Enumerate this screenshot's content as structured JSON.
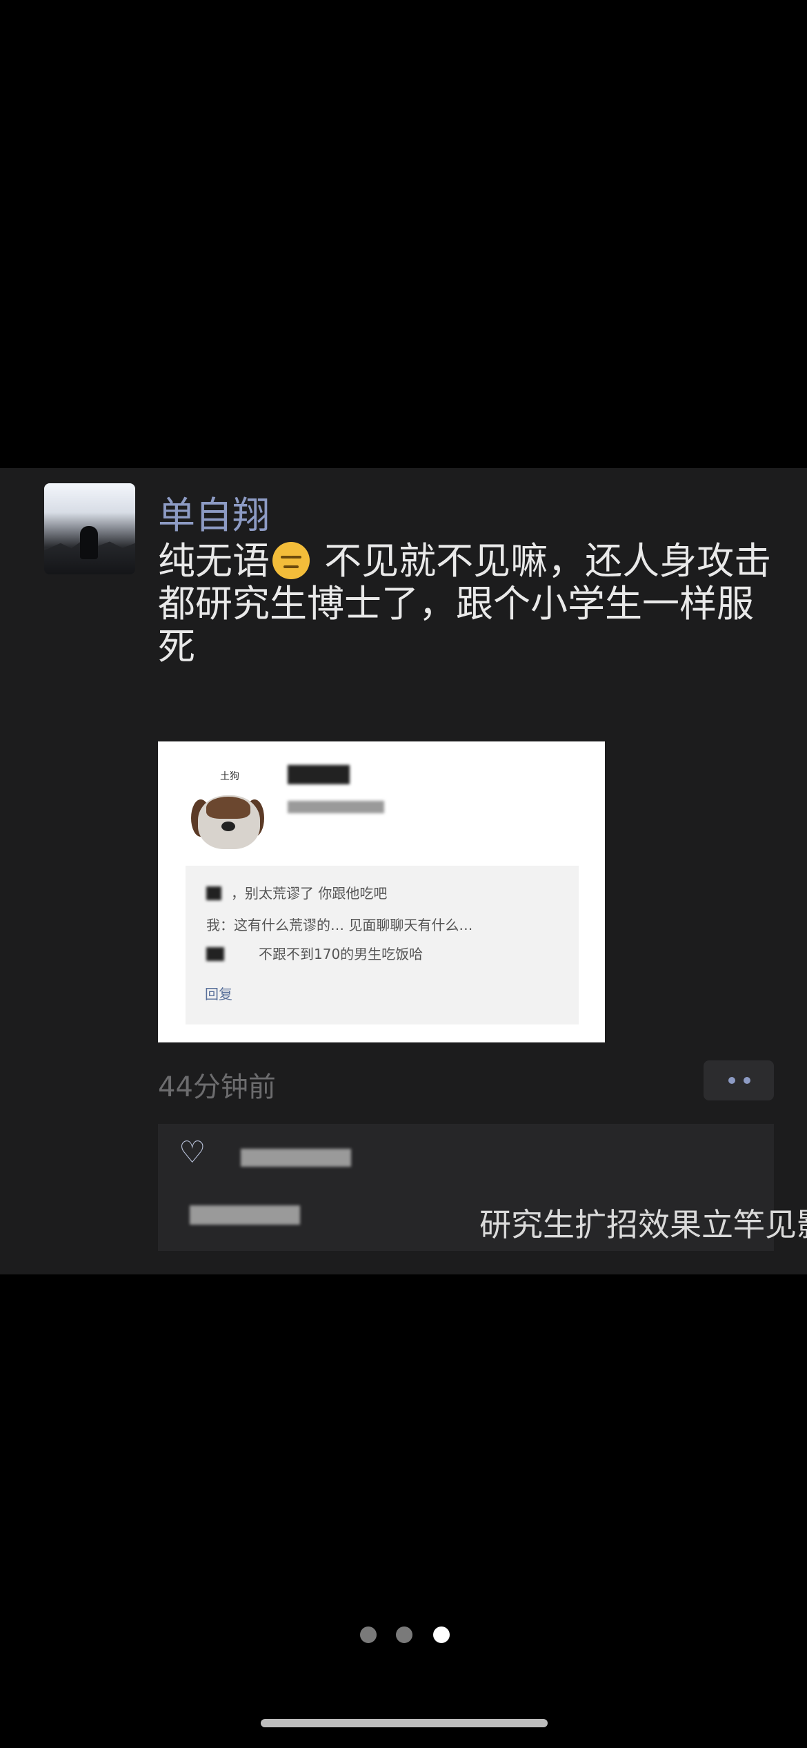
{
  "post": {
    "author": "单自翔",
    "text_line1_a": "纯无语",
    "text_line1_b": " 不见就不见嘛，还人身攻击",
    "text_line2": "都研究生博士了，跟个小学生一样服死",
    "emoji": "neutral-face",
    "time": "44分钟前",
    "more_icon": "more-dots-icon"
  },
  "screenshot": {
    "dog_label": "土狗",
    "comment1": "，别太荒谬了 你跟他吃吧",
    "comment2": "我：这有什么荒谬的… 见面聊聊天有什么…",
    "comment3": "不跟不到170的男生吃饭哈",
    "reply": "回复"
  },
  "interactions": {
    "like_icon": "heart-icon",
    "comment_text": "研究生扩招效果立竿见影",
    "comment_emoji": "grinning-cat-icon"
  },
  "pager": {
    "count": 3,
    "active_index": 2
  },
  "colors": {
    "name_blue": "#8d9bc4",
    "card_bg": "#1c1c1d",
    "text": "#e9e9e9"
  }
}
